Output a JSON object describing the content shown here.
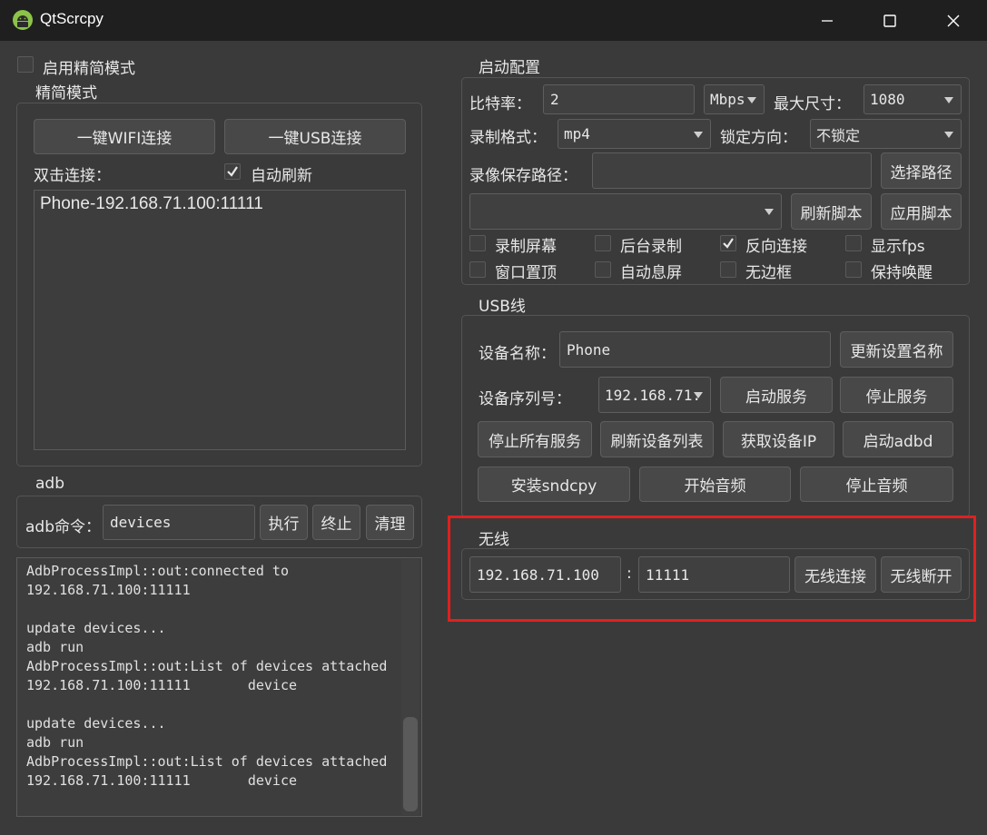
{
  "window": {
    "title": "QtScrcpy"
  },
  "left": {
    "simple_mode_label": "启用精简模式",
    "simple_group_title": "精简模式",
    "wifi_button": "一键WIFI连接",
    "usb_button": "一键USB连接",
    "dblclick_label": "双击连接：",
    "auto_refresh_label": "自动刷新",
    "devices": [
      "Phone-192.168.71.100:11111"
    ],
    "adb_group_title": "adb",
    "adb_cmd_label": "adb命令：",
    "adb_cmd_value": "devices",
    "exec_button": "执行",
    "stop_button": "终止",
    "clear_button": "清理",
    "log_text": "AdbProcessImpl::out:connected to\n192.168.71.100:11111\n\nupdate devices...\nadb run\nAdbProcessImpl::out:List of devices attached\n192.168.71.100:11111       device\n\nupdate devices...\nadb run\nAdbProcessImpl::out:List of devices attached\n192.168.71.100:11111       device"
  },
  "start_config": {
    "title": "启动配置",
    "bitrate_label": "比特率：",
    "bitrate_value": "2",
    "bitrate_unit": "Mbps",
    "max_size_label": "最大尺寸：",
    "max_size_value": "1080",
    "record_format_label": "录制格式：",
    "record_format_value": "mp4",
    "lock_orientation_label": "锁定方向：",
    "lock_orientation_value": "不锁定",
    "record_path_label": "录像保存路径：",
    "record_path_value": "",
    "select_path_button": "选择路径",
    "script_value": "",
    "refresh_script_button": "刷新脚本",
    "apply_script_button": "应用脚本",
    "checks": {
      "record_screen": "录制屏幕",
      "bg_record": "后台录制",
      "reverse_connect": "反向连接",
      "show_fps": "显示fps",
      "window_top": "窗口置顶",
      "auto_off": "自动息屏",
      "frameless": "无边框",
      "stay_awake": "保持唤醒"
    }
  },
  "usb": {
    "title": "USB线",
    "device_name_label": "设备名称：",
    "device_name_value": "Phone",
    "update_name_button": "更新设置名称",
    "serial_label": "设备序列号：",
    "serial_value": "192.168.71.",
    "start_service_button": "启动服务",
    "stop_service_button": "停止服务",
    "stop_all_button": "停止所有服务",
    "refresh_devices_button": "刷新设备列表",
    "get_ip_button": "获取设备IP",
    "start_adbd_button": "启动adbd",
    "install_sndcpy_button": "安装sndcpy",
    "start_audio_button": "开始音频",
    "stop_audio_button": "停止音频"
  },
  "wireless": {
    "title": "无线",
    "ip_value": "192.168.71.100",
    "separator": ":",
    "port_value": "11111",
    "connect_button": "无线连接",
    "disconnect_button": "无线断开"
  },
  "colors": {
    "highlight": "#e02020",
    "background": "#3a3a3a",
    "titlebar": "#1f1f1f"
  }
}
